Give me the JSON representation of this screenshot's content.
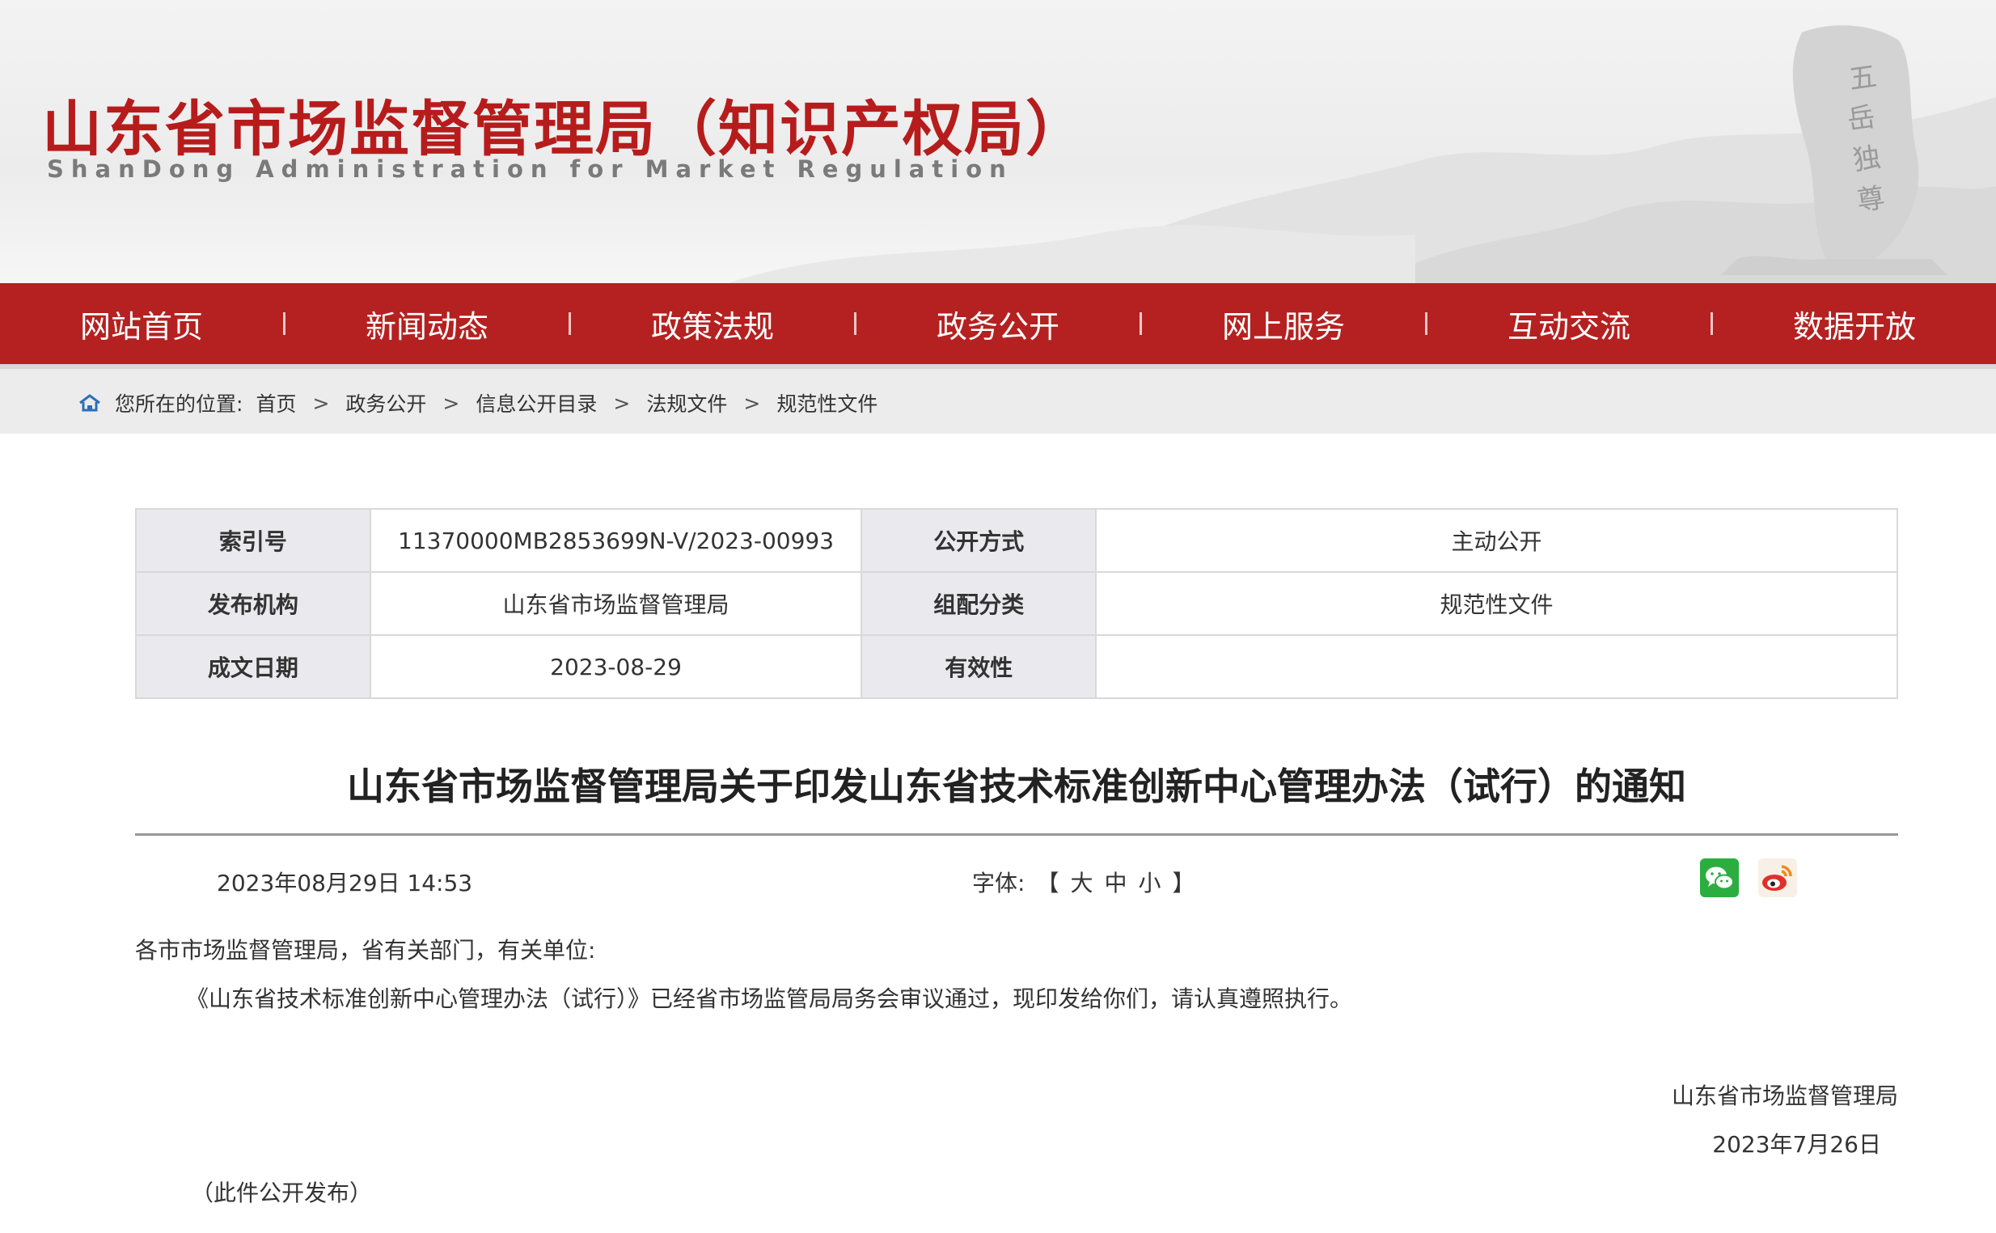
{
  "header": {
    "site_title": "山东省市场监督管理局（知识产权局）",
    "site_subtitle": "ShanDong Administration for Market Regulation"
  },
  "nav": {
    "items": [
      "网站首页",
      "新闻动态",
      "政策法规",
      "政务公开",
      "网上服务",
      "互动交流",
      "数据开放"
    ]
  },
  "breadcrumb": {
    "prefix": "您所在的位置:",
    "items": [
      "首页",
      "政务公开",
      "信息公开目录",
      "法规文件",
      "规范性文件"
    ],
    "separator": ">"
  },
  "info_table": {
    "index_label": "索引号",
    "index_value": "11370000MB2853699N-V/2023-00993",
    "disclosure_label": "公开方式",
    "disclosure_value": "主动公开",
    "publisher_label": "发布机构",
    "publisher_value": "山东省市场监督管理局",
    "category_label": "组配分类",
    "category_value": "规范性文件",
    "date_label": "成文日期",
    "date_value": "2023-08-29",
    "validity_label": "有效性",
    "validity_value": ""
  },
  "article": {
    "title": "山东省市场监督管理局关于印发山东省技术标准创新中心管理办法（试行）的通知",
    "publish_datetime": "2023年08月29日 14:53",
    "font_label": "字体:",
    "font_open": "【",
    "font_large": "大",
    "font_medium": "中",
    "font_small": "小",
    "font_close": "】",
    "salutation": "各市市场监督管理局，省有关部门，有关单位:",
    "body": "《山东省技术标准创新中心管理办法（试行）》已经省市场监管局局务会审议通过，现印发给你们，请认真遵照执行。",
    "signature": "山东省市场监督管理局",
    "sign_date": "2023年7月26日",
    "note": "（此件公开发布）"
  },
  "share": {
    "wechat_icon": "wechat-icon",
    "weibo_icon": "weibo-icon",
    "wechat_color": "#2bae3f",
    "weibo_color": "#e0302c"
  },
  "colors": {
    "brand_red": "#b52120",
    "title_red": "#b71c1c"
  }
}
